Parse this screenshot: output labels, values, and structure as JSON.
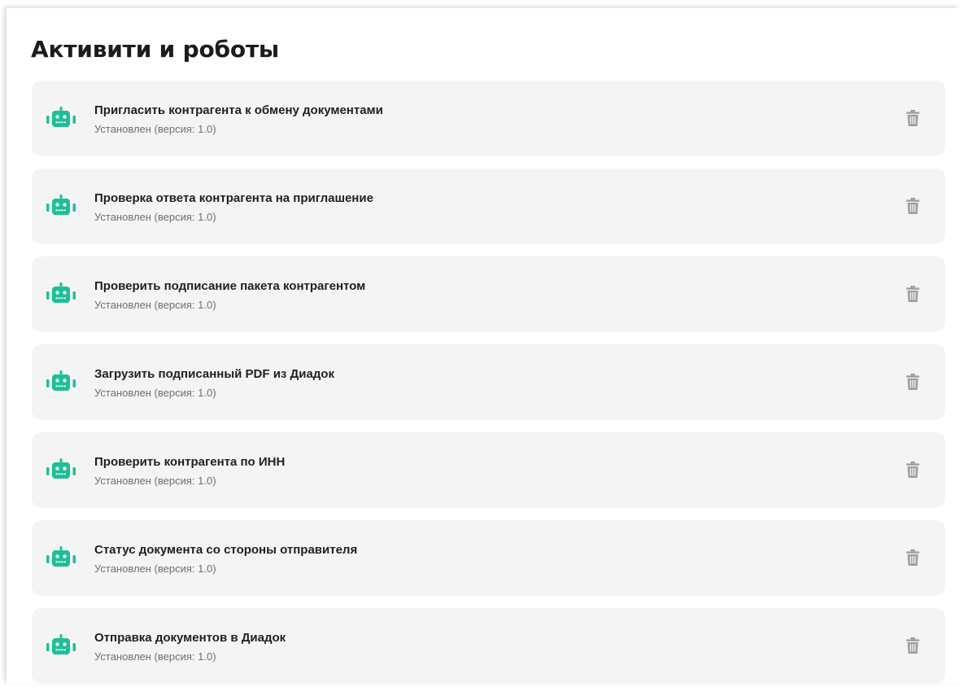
{
  "page": {
    "title": "Активити и роботы"
  },
  "colors": {
    "robot_icon": "#1fbf96",
    "card_bg": "#f4f4f4",
    "trash_icon": "#9d9d9d"
  },
  "items": [
    {
      "title": "Пригласить контрагента к обмену документами",
      "status": "Установлен (версия: 1.0)",
      "icon": "robot-icon"
    },
    {
      "title": "Проверка ответа контрагента на приглашение",
      "status": "Установлен (версия: 1.0)",
      "icon": "robot-icon"
    },
    {
      "title": "Проверить подписание пакета контрагентом",
      "status": "Установлен (версия: 1.0)",
      "icon": "robot-icon"
    },
    {
      "title": "Загрузить подписанный PDF из Диадок",
      "status": "Установлен (версия: 1.0)",
      "icon": "robot-icon"
    },
    {
      "title": "Проверить контрагента по ИНН",
      "status": "Установлен (версия: 1.0)",
      "icon": "robot-icon"
    },
    {
      "title": "Статус документа со стороны отправителя",
      "status": "Установлен (версия: 1.0)",
      "icon": "robot-icon"
    },
    {
      "title": "Отправка документов в Диадок",
      "status": "Установлен (версия: 1.0)",
      "icon": "robot-icon"
    }
  ]
}
